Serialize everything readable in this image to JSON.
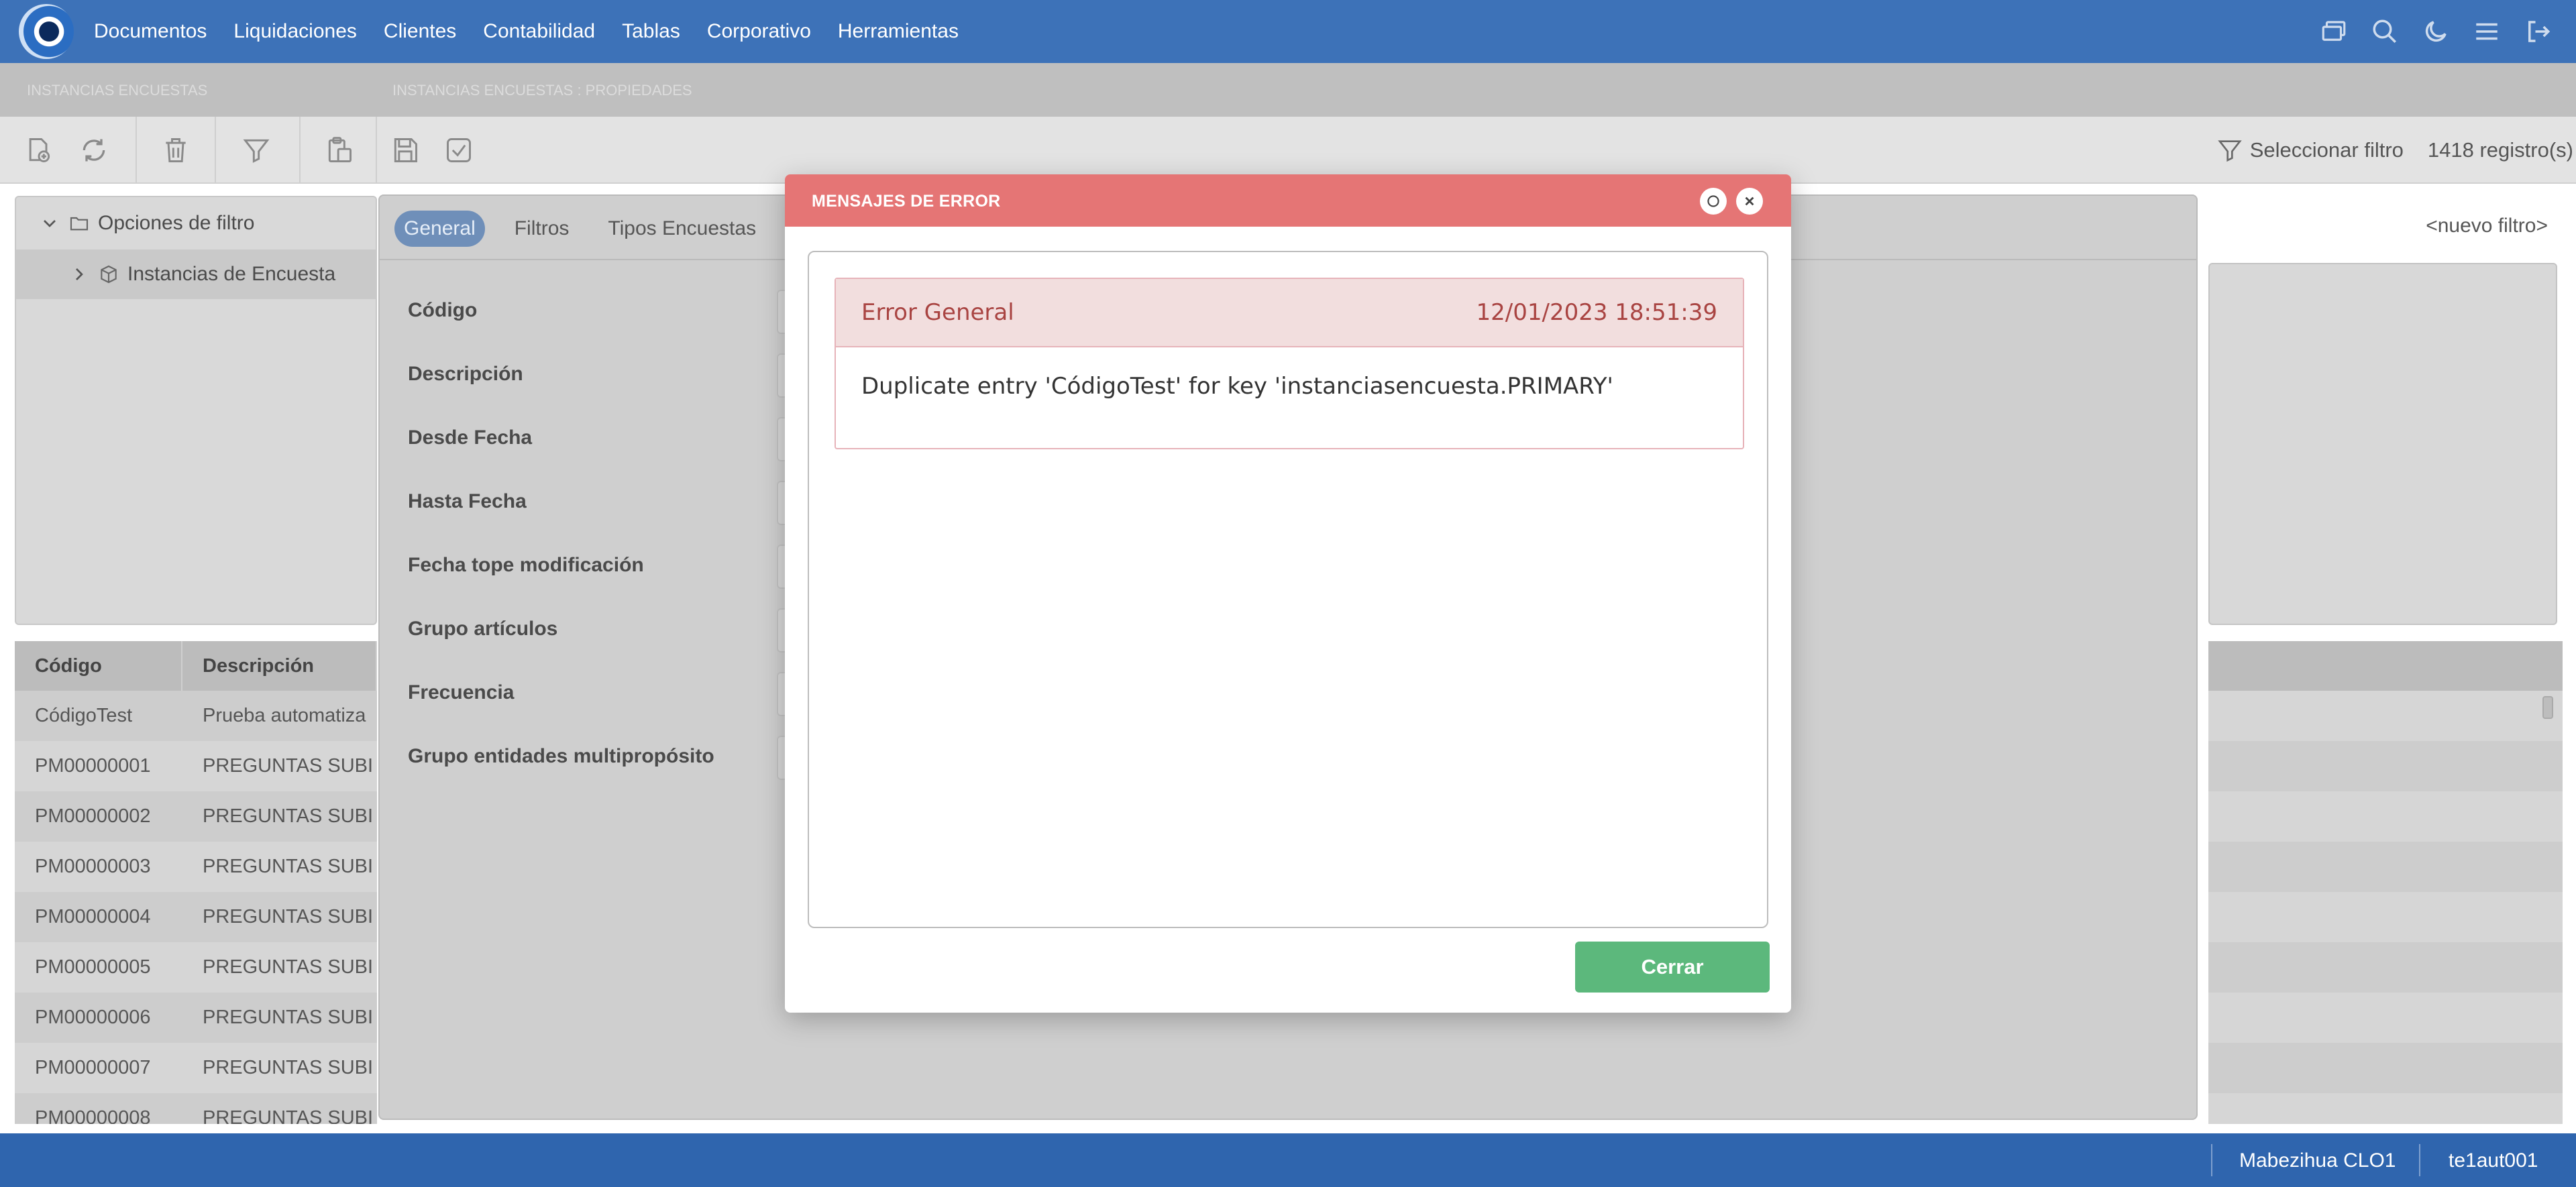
{
  "nav": {
    "items": [
      "Documentos",
      "Liquidaciones",
      "Clientes",
      "Contabilidad",
      "Tablas",
      "Corporativo",
      "Herramientas"
    ]
  },
  "panels": {
    "left_title": "INSTANCIAS ENCUESTAS",
    "right_title": "INSTANCIAS ENCUESTAS : PROPIEDADES"
  },
  "toolbar": {
    "filter_select": "Seleccionar filtro",
    "record_count": "1418 registro(s)"
  },
  "tree": {
    "root": "Opciones de filtro",
    "child": "Instancias de Encuesta"
  },
  "table": {
    "headers": [
      "Código",
      "Descripción"
    ],
    "rows": [
      [
        "CódigoTest",
        "Prueba automatiza"
      ],
      [
        "PM00000001",
        "PREGUNTAS SUBI"
      ],
      [
        "PM00000002",
        "PREGUNTAS SUBI"
      ],
      [
        "PM00000003",
        "PREGUNTAS SUBI"
      ],
      [
        "PM00000004",
        "PREGUNTAS SUBI"
      ],
      [
        "PM00000005",
        "PREGUNTAS SUBI"
      ],
      [
        "PM00000006",
        "PREGUNTAS SUBI"
      ],
      [
        "PM00000007",
        "PREGUNTAS SUBI"
      ],
      [
        "PM00000008",
        "PREGUNTAS SUBI"
      ]
    ]
  },
  "props": {
    "tabs": [
      "General",
      "Filtros",
      "Tipos Encuestas"
    ],
    "fields": [
      "Código",
      "Descripción",
      "Desde Fecha",
      "Hasta Fecha",
      "Fecha tope modificación",
      "Grupo artículos",
      "Frecuencia",
      "Grupo entidades multipropósito"
    ]
  },
  "filter": {
    "new_filter": "<nuevo filtro>"
  },
  "dialog": {
    "title": "MENSAJES DE ERROR",
    "error_title": "Error General",
    "error_time": "12/01/2023 18:51:39",
    "error_message": "Duplicate entry 'CódigoTest' for key 'instanciasencuesta.PRIMARY'",
    "close_label": "Cerrar"
  },
  "status": {
    "user": "Mabezihua CLO1",
    "code": "te1aut001"
  },
  "colors": {
    "nav_bg": "#3d72b8",
    "dialog_header": "#e57575",
    "error_bg": "#f2dede",
    "error_text": "#a94442",
    "close_button": "#5cb87c",
    "status_bg": "#2f65ae"
  }
}
